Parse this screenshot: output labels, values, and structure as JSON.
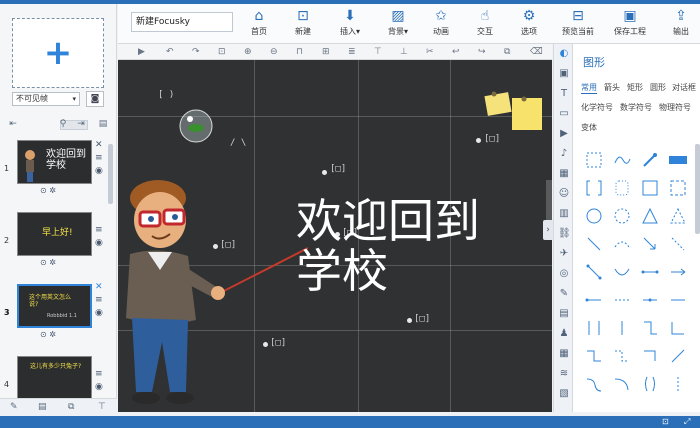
{
  "left_panel": {
    "visibility_select": "不可见帧",
    "slides": [
      {
        "number": "1",
        "thumb_text": "欢迎回到\n学校"
      },
      {
        "number": "2",
        "thumb_text": "早上好!"
      },
      {
        "number": "3",
        "thumb_text": "这个用英文怎么说?",
        "sub_text": "Robbbid 1.1",
        "selected": true
      },
      {
        "number": "4",
        "thumb_text": "这儿有多少只兔子?"
      }
    ]
  },
  "toolbar": {
    "project_title": "新建Focusky",
    "buttons": [
      {
        "label": "首页",
        "icon": "home-icon"
      },
      {
        "label": "新建",
        "icon": "new-frame-icon"
      },
      {
        "label": "插入▾",
        "icon": "insert-icon"
      },
      {
        "label": "背景▾",
        "icon": "background-icon"
      },
      {
        "label": "动画",
        "icon": "animation-star-icon"
      },
      {
        "label": "交互",
        "icon": "interaction-icon"
      },
      {
        "label": "选项",
        "icon": "gear-icon"
      },
      {
        "label": "预览当前",
        "icon": "preview-icon"
      },
      {
        "label": "保存工程",
        "icon": "save-icon"
      },
      {
        "label": "输出",
        "icon": "export-icon"
      }
    ]
  },
  "canvas": {
    "title_line1": "欢迎回到",
    "title_line2": "学校",
    "background_color": "#2f3132"
  },
  "right_panel": {
    "heading": "图形",
    "tabs_row1": [
      "常用",
      "箭头",
      "矩形",
      "圆形",
      "对话框"
    ],
    "tabs_row2": [
      "化学符号",
      "数学符号",
      "物理符号"
    ],
    "tabs_row3": [
      "变体"
    ],
    "active_tab": "常用",
    "accent_color": "#2b6fb8"
  }
}
